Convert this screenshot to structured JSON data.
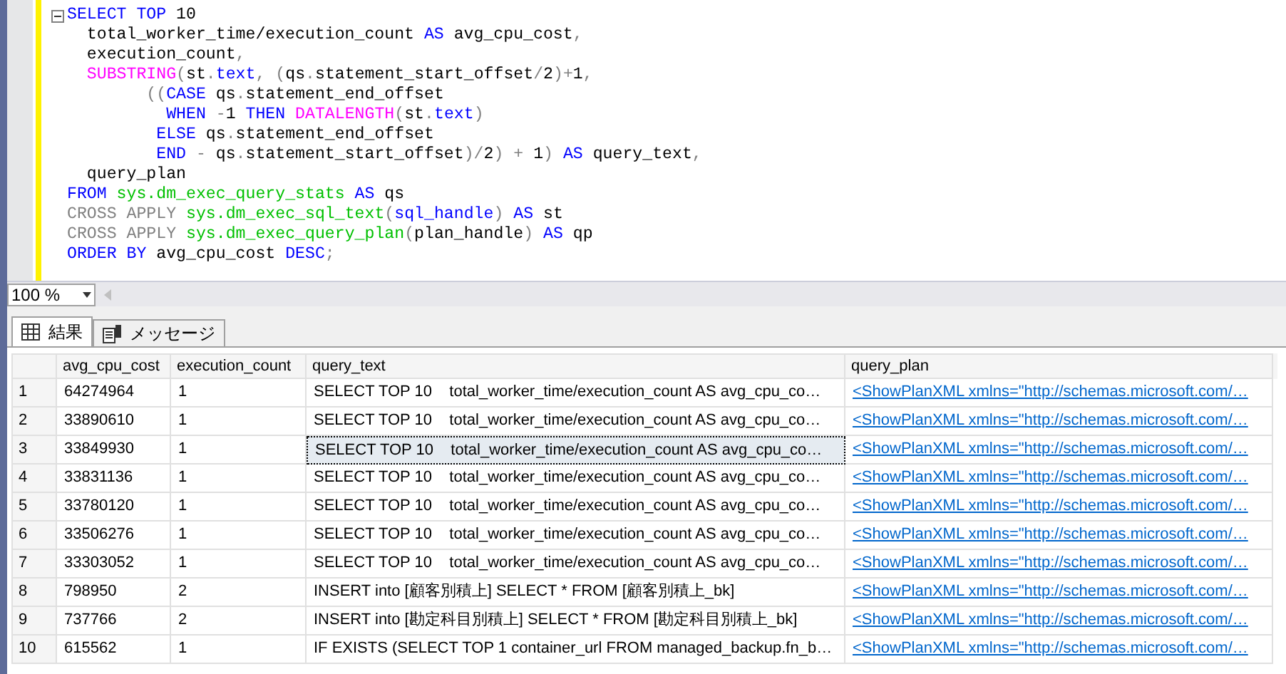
{
  "editor": {
    "lines": [
      [
        {
          "t": "SELECT ",
          "kind": "keyword"
        },
        {
          "t": "TOP",
          "kind": "keyword"
        },
        {
          "t": " 10",
          "kind": "plain"
        }
      ],
      [
        {
          "t": "  total_worker_time/execution_count ",
          "kind": "plain"
        },
        {
          "t": "AS",
          "kind": "keyword"
        },
        {
          "t": " avg_cpu_cost",
          "kind": "plain"
        },
        {
          "t": ",",
          "kind": "operator"
        }
      ],
      [
        {
          "t": "  execution_count",
          "kind": "plain"
        },
        {
          "t": ",",
          "kind": "operator"
        }
      ],
      [
        {
          "t": "  SUBSTRING",
          "kind": "function"
        },
        {
          "t": "(",
          "kind": "operator"
        },
        {
          "t": "st",
          "kind": "plain"
        },
        {
          "t": ".",
          "kind": "operator"
        },
        {
          "t": "text",
          "kind": "keyword"
        },
        {
          "t": ", (",
          "kind": "operator"
        },
        {
          "t": "qs",
          "kind": "plain"
        },
        {
          "t": ".",
          "kind": "operator"
        },
        {
          "t": "statement_start_offset",
          "kind": "plain"
        },
        {
          "t": "/",
          "kind": "operator"
        },
        {
          "t": "2",
          "kind": "plain"
        },
        {
          "t": ")+",
          "kind": "operator"
        },
        {
          "t": "1",
          "kind": "plain"
        },
        {
          "t": ",",
          "kind": "operator"
        }
      ],
      [
        {
          "t": "        ((",
          "kind": "operator"
        },
        {
          "t": "CASE",
          "kind": "keyword"
        },
        {
          "t": " qs",
          "kind": "plain"
        },
        {
          "t": ".",
          "kind": "operator"
        },
        {
          "t": "statement_end_offset",
          "kind": "plain"
        }
      ],
      [
        {
          "t": "          WHEN",
          "kind": "keyword"
        },
        {
          "t": " -",
          "kind": "operator"
        },
        {
          "t": "1 ",
          "kind": "plain"
        },
        {
          "t": "THEN ",
          "kind": "keyword"
        },
        {
          "t": "DATALENGTH",
          "kind": "function"
        },
        {
          "t": "(",
          "kind": "operator"
        },
        {
          "t": "st",
          "kind": "plain"
        },
        {
          "t": ".",
          "kind": "operator"
        },
        {
          "t": "text",
          "kind": "keyword"
        },
        {
          "t": ")",
          "kind": "operator"
        }
      ],
      [
        {
          "t": "         ELSE",
          "kind": "keyword"
        },
        {
          "t": " qs",
          "kind": "plain"
        },
        {
          "t": ".",
          "kind": "operator"
        },
        {
          "t": "statement_end_offset",
          "kind": "plain"
        }
      ],
      [
        {
          "t": "         END",
          "kind": "keyword"
        },
        {
          "t": " - ",
          "kind": "operator"
        },
        {
          "t": "qs",
          "kind": "plain"
        },
        {
          "t": ".",
          "kind": "operator"
        },
        {
          "t": "statement_start_offset",
          "kind": "plain"
        },
        {
          "t": ")/",
          "kind": "operator"
        },
        {
          "t": "2",
          "kind": "plain"
        },
        {
          "t": ") + ",
          "kind": "operator"
        },
        {
          "t": "1",
          "kind": "plain"
        },
        {
          "t": ") ",
          "kind": "operator"
        },
        {
          "t": "AS",
          "kind": "keyword"
        },
        {
          "t": " query_text",
          "kind": "plain"
        },
        {
          "t": ",",
          "kind": "operator"
        }
      ],
      [
        {
          "t": "  query_plan",
          "kind": "plain"
        }
      ],
      [
        {
          "t": "FROM ",
          "kind": "keyword"
        },
        {
          "t": "sys.dm_exec_query_stats ",
          "kind": "system"
        },
        {
          "t": "AS",
          "kind": "keyword"
        },
        {
          "t": " qs",
          "kind": "plain"
        }
      ],
      [
        {
          "t": "CROSS APPLY ",
          "kind": "operator"
        },
        {
          "t": "sys.dm_exec_sql_text",
          "kind": "system"
        },
        {
          "t": "(",
          "kind": "operator"
        },
        {
          "t": "sql_handle",
          "kind": "keyword"
        },
        {
          "t": ") ",
          "kind": "operator"
        },
        {
          "t": "AS",
          "kind": "keyword"
        },
        {
          "t": " st",
          "kind": "plain"
        }
      ],
      [
        {
          "t": "CROSS APPLY ",
          "kind": "operator"
        },
        {
          "t": "sys.dm_exec_query_plan",
          "kind": "system"
        },
        {
          "t": "(",
          "kind": "operator"
        },
        {
          "t": "plan_handle",
          "kind": "plain"
        },
        {
          "t": ") ",
          "kind": "operator"
        },
        {
          "t": "AS",
          "kind": "keyword"
        },
        {
          "t": " qp",
          "kind": "plain"
        }
      ],
      [
        {
          "t": "ORDER ",
          "kind": "keyword"
        },
        {
          "t": "BY",
          "kind": "keyword"
        },
        {
          "t": " avg_cpu_cost ",
          "kind": "plain"
        },
        {
          "t": "DESC",
          "kind": "keyword"
        },
        {
          "t": ";",
          "kind": "operator"
        }
      ]
    ]
  },
  "zoom": {
    "value": "100 %"
  },
  "tabs": [
    {
      "label": "結果",
      "selected": true,
      "kind": "grid"
    },
    {
      "label": "メッセージ",
      "selected": false,
      "kind": "message"
    }
  ],
  "table": {
    "columns": [
      "avg_cpu_cost",
      "execution_count",
      "query_text",
      "query_plan"
    ],
    "rows": [
      {
        "n": "1",
        "cells": [
          "64274964",
          "1",
          "SELECT TOP 10    total_worker_time/execution_count AS avg_cpu_co…",
          "<ShowPlanXML xmlns=\"http://schemas.microsoft.com/…"
        ],
        "selected": false
      },
      {
        "n": "2",
        "cells": [
          "33890610",
          "1",
          "SELECT TOP 10    total_worker_time/execution_count AS avg_cpu_co…",
          "<ShowPlanXML xmlns=\"http://schemas.microsoft.com/…"
        ],
        "selected": false
      },
      {
        "n": "3",
        "cells": [
          "33849930",
          "1",
          "SELECT TOP 10    total_worker_time/execution_count AS avg_cpu_co…",
          "<ShowPlanXML xmlns=\"http://schemas.microsoft.com/…"
        ],
        "selected": true
      },
      {
        "n": "4",
        "cells": [
          "33831136",
          "1",
          "SELECT TOP 10    total_worker_time/execution_count AS avg_cpu_co…",
          "<ShowPlanXML xmlns=\"http://schemas.microsoft.com/…"
        ],
        "selected": false
      },
      {
        "n": "5",
        "cells": [
          "33780120",
          "1",
          "SELECT TOP 10    total_worker_time/execution_count AS avg_cpu_co…",
          "<ShowPlanXML xmlns=\"http://schemas.microsoft.com/…"
        ],
        "selected": false
      },
      {
        "n": "6",
        "cells": [
          "33506276",
          "1",
          "SELECT TOP 10    total_worker_time/execution_count AS avg_cpu_co…",
          "<ShowPlanXML xmlns=\"http://schemas.microsoft.com/…"
        ],
        "selected": false
      },
      {
        "n": "7",
        "cells": [
          "33303052",
          "1",
          "SELECT TOP 10    total_worker_time/execution_count AS avg_cpu_co…",
          "<ShowPlanXML xmlns=\"http://schemas.microsoft.com/…"
        ],
        "selected": false
      },
      {
        "n": "8",
        "cells": [
          "798950",
          "2",
          "INSERT into [顧客別積上] SELECT * FROM [顧客別積上_bk]",
          "<ShowPlanXML xmlns=\"http://schemas.microsoft.com/…"
        ],
        "selected": false
      },
      {
        "n": "9",
        "cells": [
          "737766",
          "2",
          "INSERT into [勘定科目別積上] SELECT * FROM [勘定科目別積上_bk]",
          "<ShowPlanXML xmlns=\"http://schemas.microsoft.com/…"
        ],
        "selected": false
      },
      {
        "n": "10",
        "cells": [
          "615562",
          "1",
          "IF EXISTS (SELECT TOP 1 container_url FROM managed_backup.fn_b…",
          "<ShowPlanXML xmlns=\"http://schemas.microsoft.com/…"
        ],
        "selected": false
      }
    ]
  }
}
